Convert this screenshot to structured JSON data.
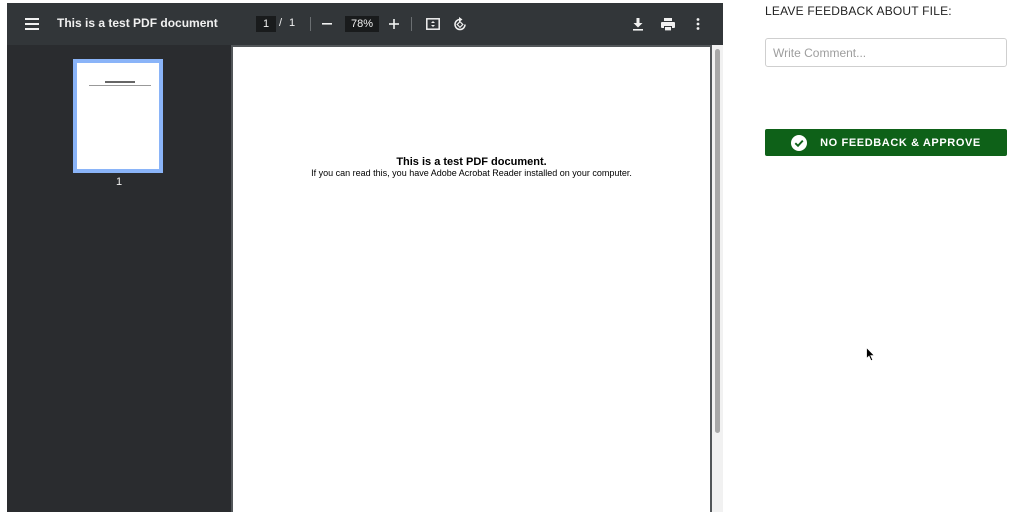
{
  "viewer": {
    "doc_title": "This is a test PDF document",
    "page_current": "1",
    "page_separator": "/",
    "page_total": "1",
    "zoom": "78%",
    "thumbnail_page_number": "1",
    "icons": {
      "menu": "menu-icon",
      "zoom_out": "minus-icon",
      "zoom_in": "plus-icon",
      "fit": "fit-page-icon",
      "rotate": "rotate-icon",
      "download": "download-icon",
      "print": "print-icon",
      "more": "more-vertical-icon"
    }
  },
  "document": {
    "heading": "This is a test PDF document.",
    "body": "If you can read this, you have Adobe Acrobat Reader installed on your computer."
  },
  "feedback": {
    "heading": "LEAVE FEEDBACK ABOUT FILE:",
    "comment_placeholder": "Write Comment...",
    "comment_value": "",
    "approve_label": "NO FEEDBACK & APPROVE",
    "approve_color": "#0e6118"
  }
}
